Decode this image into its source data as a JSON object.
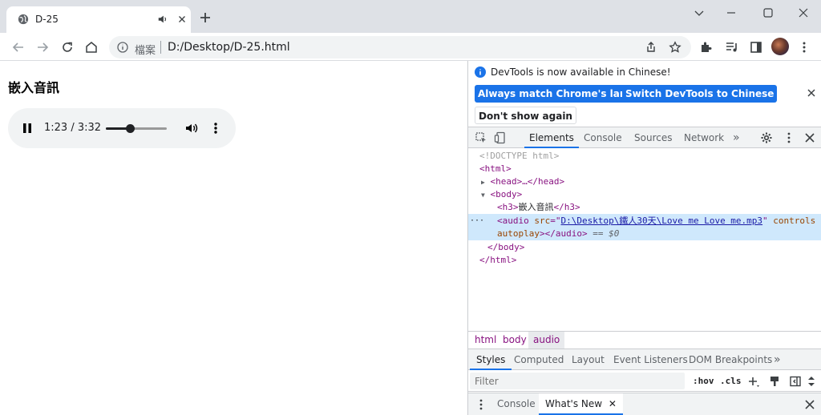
{
  "tab": {
    "title": "D-25"
  },
  "omnibox": {
    "label": "檔案",
    "url": "D:/Desktop/D-25.html"
  },
  "page": {
    "heading": "嵌入音訊",
    "audio": {
      "time": "1:23 / 3:32",
      "progress": 0.39
    }
  },
  "devtools": {
    "info": "DevTools is now available in Chinese!",
    "btn_match": "Always match Chrome's language",
    "btn_switch": "Switch DevTools to Chinese",
    "btn_dismiss": "Don't show again",
    "tabs": [
      "Elements",
      "Console",
      "Sources",
      "Network"
    ],
    "more": "»",
    "dom": {
      "doctype": "<!DOCTYPE html>",
      "html_open": "<html>",
      "head": "<head>…</head>",
      "body_open": "<body>",
      "h3_open": "<h3>",
      "h3_text": "嵌入音訊",
      "h3_close": "</h3>",
      "audio_open": "<audio",
      "src_attr": "src",
      "src_val": "D:\\Desktop\\鐵人30天\\Love me Love me.mp3",
      "controls": "controls",
      "autoplay": "autoplay",
      "audio_close": "></audio>",
      "eq": "== $0",
      "body_close": "</body>",
      "html_close": "</html>",
      "dots": "···"
    },
    "crumbs": [
      "html",
      "body",
      "audio"
    ],
    "sub_tabs": [
      "Styles",
      "Computed",
      "Layout",
      "Event Listeners",
      "DOM Breakpoints"
    ],
    "filter_placeholder": "Filter",
    "hov": ":hov",
    "cls": ".cls",
    "drawer": {
      "console": "Console",
      "whats_new": "What's New"
    }
  }
}
